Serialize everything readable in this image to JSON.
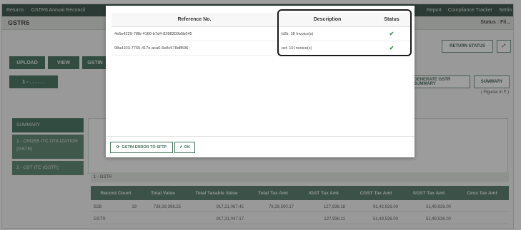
{
  "topbar": {
    "items": [
      "Returns",
      "GSTR6 Annual Reconcil"
    ],
    "right_items": [
      "Report",
      "Compliance Tracker",
      "Settin"
    ]
  },
  "page": {
    "title": "GSTR6",
    "status": "Status : Fil..."
  },
  "actions": {
    "upload": "UPLOAD",
    "view": "VIEW",
    "gstin": "GSTIN",
    "return_status": "RETURN STATUS",
    "generate_summary": "GENERATE GSTR SUMMARY",
    "summary": "SUMMARY",
    "figures_note": "( Figures in ₹ )"
  },
  "sidebar": {
    "summary": "SUMMARY",
    "item1": "1 - CROSS ITC UTILIZATION (GSTR)",
    "item2": "2 - GST ITC (GSTR)"
  },
  "summary_table": {
    "section_label": "1 - GSTR",
    "headers": [
      "Record Count",
      "Total Value",
      "Total Taxable Value",
      "Total Tax Amt",
      "IGST Tax Amt",
      "CGST Tax Amt",
      "SGST Tax Amt",
      "Cess Tax Amt"
    ],
    "rows": [
      {
        "label": "B2B",
        "cells": [
          "19",
          "726,39,396.25",
          "917,21,067.45",
          "79,29,500.17",
          "127,936.18",
          "91,42,926.00",
          "51,49,926.00",
          ""
        ]
      },
      {
        "label": "GSTR",
        "cells": [
          "",
          "",
          "917,21,047.17",
          "",
          "127,936.11",
          "51,49,526.00",
          "51,49,526.00",
          ""
        ]
      }
    ]
  },
  "modal": {
    "headers": {
      "ref": "Reference No.",
      "description": "Description",
      "status": "Status"
    },
    "rows": [
      {
        "ref": "4e5e4229-78fb-4160-b7d4-8288309b5b645",
        "description": "b2b: 18 Invoice(s)",
        "status": "✔"
      },
      {
        "ref": "98a4103-7765-417e-aca6-6e8c578d8596",
        "description": "isd: 10 Invoice(s)",
        "status": "✔"
      }
    ],
    "btn_error": "GSTIN ERROR TO SFTP",
    "btn_ok": "OK"
  },
  "colors": {
    "primary_green": "#3d6b57",
    "check_green": "#2f8a4a"
  }
}
